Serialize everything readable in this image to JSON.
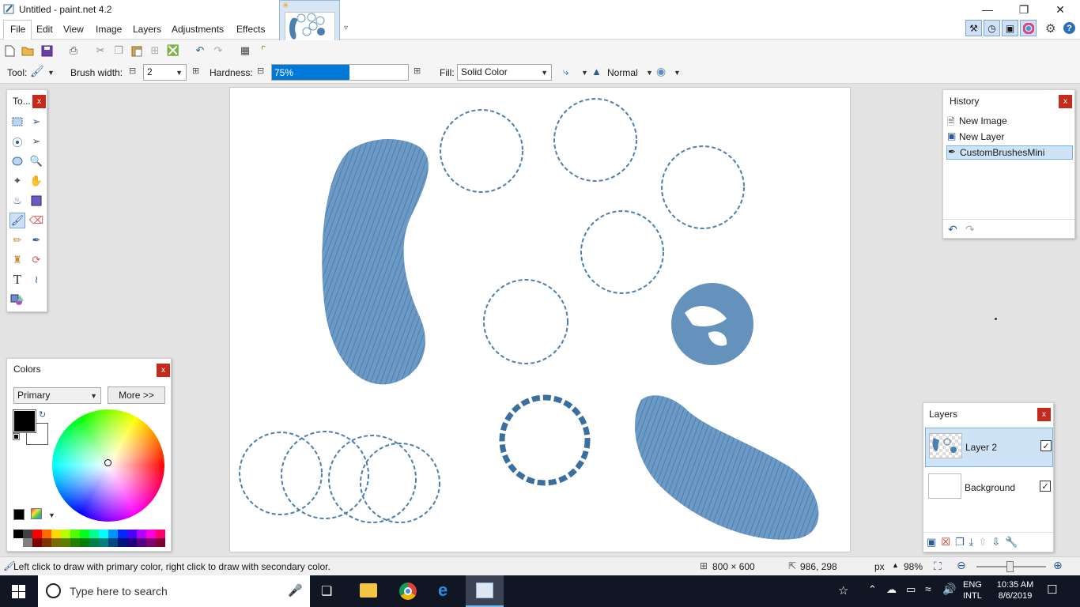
{
  "window": {
    "title": "Untitled - paint.net 4.2"
  },
  "menu": {
    "items": [
      "File",
      "Edit",
      "View",
      "Image",
      "Layers",
      "Adjustments",
      "Effects"
    ]
  },
  "toolbar": {
    "tool_label": "Tool:",
    "brush_width_label": "Brush width:",
    "brush_width_value": "2",
    "hardness_label": "Hardness:",
    "hardness_value": "75%",
    "hardness_fraction": 0.75,
    "fill_label": "Fill:",
    "fill_value": "Solid Color",
    "blend_mode": "Normal"
  },
  "tools_panel": {
    "title": "To..."
  },
  "colors_panel": {
    "title": "Colors",
    "mode": "Primary",
    "more_button": "More >>",
    "primary_color": "#000000",
    "secondary_color": "#ffffff",
    "palette": [
      "#000000",
      "#404040",
      "#ff0000",
      "#ff6a00",
      "#ffd800",
      "#b6ff00",
      "#4cff00",
      "#00ff21",
      "#00ff90",
      "#00ffff",
      "#0094ff",
      "#0026ff",
      "#4800ff",
      "#b200ff",
      "#ff00dc",
      "#ff006e"
    ],
    "palette_dark": [
      "#ffffff",
      "#808080",
      "#7f0000",
      "#7f3300",
      "#7f6a00",
      "#5b7f00",
      "#267f00",
      "#007f0e",
      "#007f46",
      "#007f7f",
      "#004a7f",
      "#00137f",
      "#21007f",
      "#57007f",
      "#7f006e",
      "#7f0037"
    ]
  },
  "history_panel": {
    "title": "History",
    "items": [
      {
        "label": "New Image",
        "selected": false
      },
      {
        "label": "New Layer",
        "selected": false
      },
      {
        "label": "CustomBrushesMini",
        "selected": true
      }
    ]
  },
  "layers_panel": {
    "title": "Layers",
    "layers": [
      {
        "name": "Layer 2",
        "selected": true,
        "visible": true
      },
      {
        "name": "Background",
        "selected": false,
        "visible": true
      }
    ]
  },
  "status": {
    "hint": "Left click to draw with primary color, right click to draw with secondary color.",
    "image_size": "800 × 600",
    "cursor_pos": "986, 298",
    "units": "px",
    "zoom": "98%"
  },
  "taskbar": {
    "search_placeholder": "Type here to search",
    "lang_top": "ENG",
    "lang_bottom": "INTL",
    "time": "10:35 AM",
    "date": "8/6/2019"
  },
  "colors": {
    "accent": "#0078d7",
    "brush_blue": "#4a7fb0",
    "close_red": "#c42b1c"
  }
}
